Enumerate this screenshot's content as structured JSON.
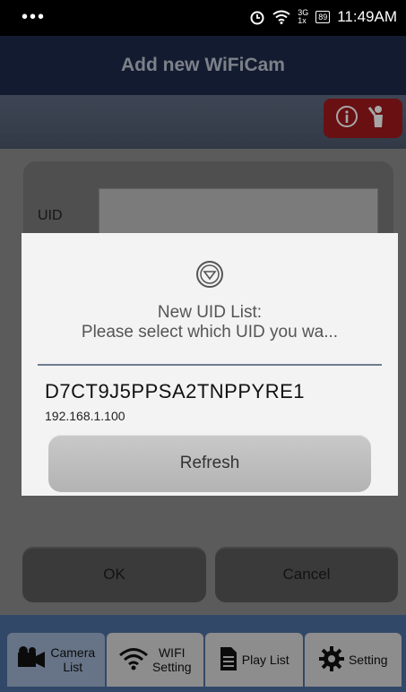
{
  "status_bar": {
    "menu_dots": "•••",
    "network_top": "3G",
    "network_bottom": "1x",
    "battery": "89",
    "time": "11:49AM"
  },
  "header": {
    "title": "Add new WiFiCam"
  },
  "form": {
    "uid_label": "UID",
    "uid_value": ""
  },
  "dialog": {
    "title_line1": "New UID List:",
    "title_line2": "Please select which UID you wa...",
    "items": [
      {
        "uid": "D7CT9J5PPSA2TNPPYRE1",
        "ip": "192.168.1.100"
      }
    ],
    "refresh_label": "Refresh"
  },
  "actions": {
    "ok_label": "OK",
    "cancel_label": "Cancel"
  },
  "tabs": [
    {
      "label_line1": "Camera",
      "label_line2": "List",
      "icon": "camera-icon"
    },
    {
      "label_line1": "WIFI",
      "label_line2": "Setting",
      "icon": "wifi-icon"
    },
    {
      "label_line1": "Play List",
      "label_line2": "",
      "icon": "document-icon"
    },
    {
      "label_line1": "Setting",
      "label_line2": "",
      "icon": "gear-icon"
    }
  ],
  "colors": {
    "title_bar": "#1c2a4a",
    "info_badge": "#a1191c",
    "tab_bar": "#4d6fa0"
  }
}
